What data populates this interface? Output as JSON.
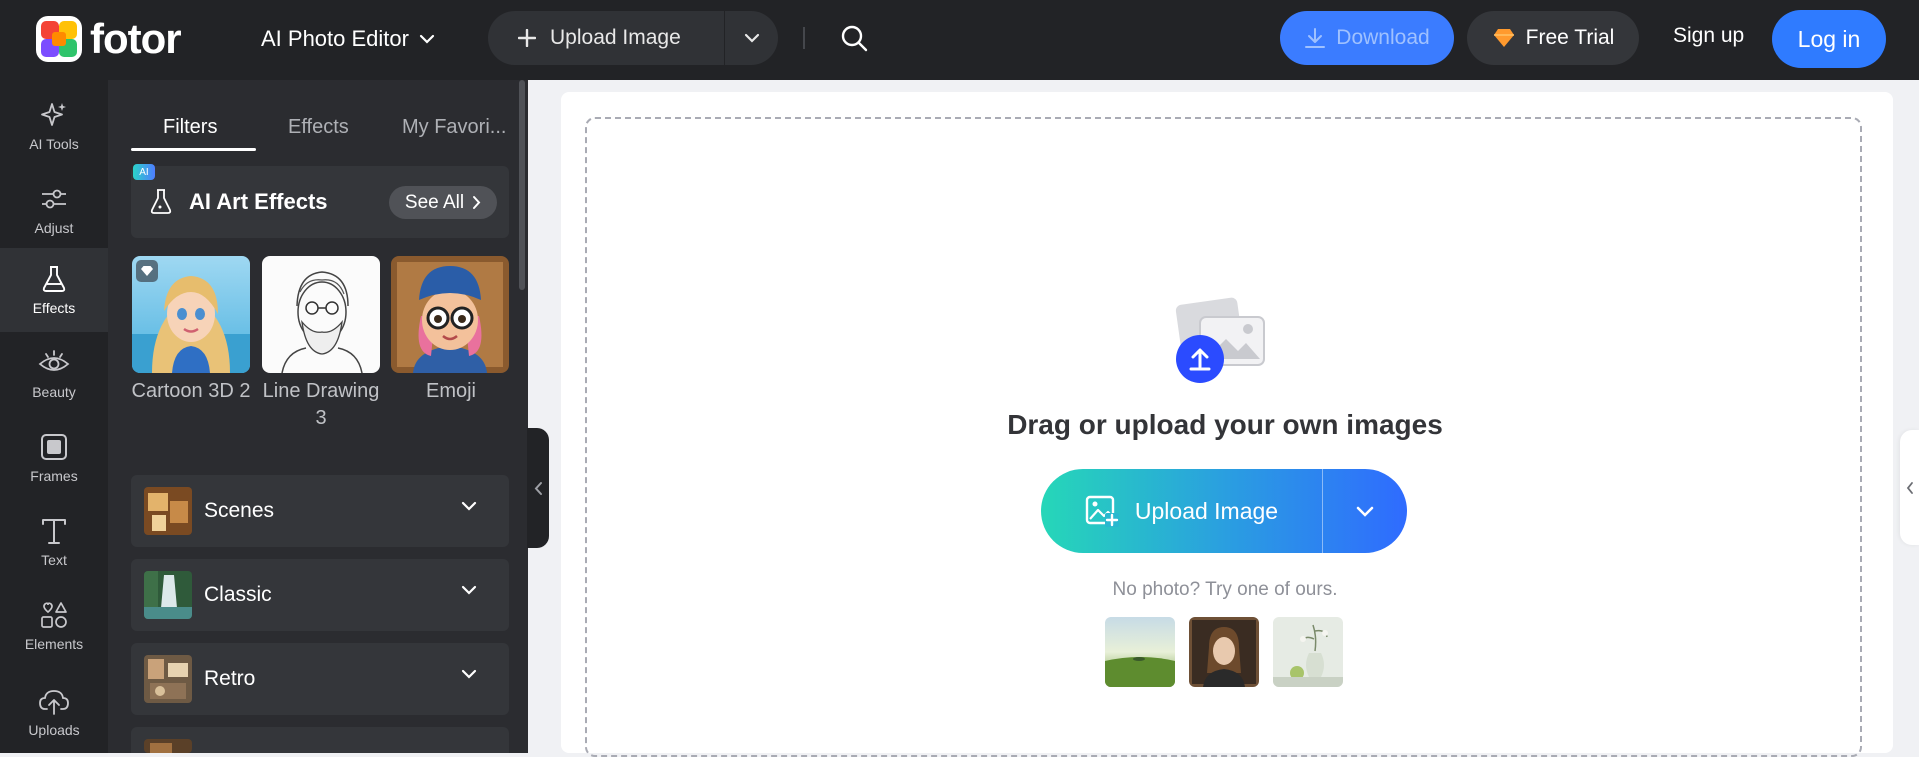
{
  "header": {
    "logo_text": "fotor",
    "editor_mode": "AI Photo Editor",
    "upload_label": "Upload Image",
    "download_label": "Download",
    "free_trial_label": "Free Trial",
    "signup_label": "Sign up",
    "login_label": "Log in",
    "colors": {
      "bar": "#222326",
      "download": "#3b7cff",
      "login": "#2f7bff"
    }
  },
  "left_rail": {
    "items": [
      {
        "label": "AI Tools",
        "icon": "sparkle-icon"
      },
      {
        "label": "Adjust",
        "icon": "sliders-icon"
      },
      {
        "label": "Effects",
        "icon": "flask-icon",
        "active": true
      },
      {
        "label": "Beauty",
        "icon": "eye-icon"
      },
      {
        "label": "Frames",
        "icon": "frame-icon"
      },
      {
        "label": "Text",
        "icon": "text-icon"
      },
      {
        "label": "Elements",
        "icon": "shapes-icon"
      },
      {
        "label": "Uploads",
        "icon": "cloud-upload-icon"
      }
    ]
  },
  "panel": {
    "tabs": [
      "Filters",
      "Effects",
      "My Favori..."
    ],
    "active_tab": "Filters",
    "ai_badge": "AI",
    "ai_card_title": "AI Art Effects",
    "see_all_label": "See All",
    "effects": [
      {
        "label": "Cartoon 3D 2",
        "premium": true
      },
      {
        "label": "Line Drawing 3",
        "premium": false
      },
      {
        "label": "Emoji",
        "premium": false
      }
    ],
    "categories": [
      {
        "label": "Scenes"
      },
      {
        "label": "Classic"
      },
      {
        "label": "Retro"
      }
    ]
  },
  "canvas": {
    "drop_title": "Drag or upload your own images",
    "upload_label": "Upload Image",
    "try_text": "No photo? Try one of ours.",
    "samples": [
      "landscape",
      "portrait",
      "still-life"
    ]
  }
}
